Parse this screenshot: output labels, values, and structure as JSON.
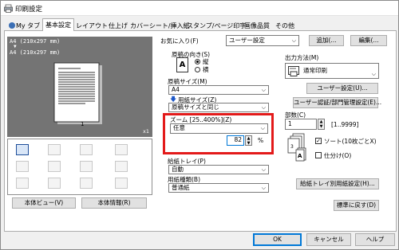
{
  "window": {
    "title": "印刷設定"
  },
  "tabs": [
    "My タブ",
    "基本設定",
    "レイアウト",
    "仕上げ",
    "カバーシート/挿入紙",
    "スタンプ/ページ印字",
    "画像品質",
    "その他"
  ],
  "preview": {
    "line1": "A4 (210x297 mm)",
    "line2": "A4 (210x297 mm)",
    "page_number": "1",
    "zoom": "x1"
  },
  "left_buttons": {
    "view": "本体ビュー(V)",
    "info": "本体情報(R)"
  },
  "favorites": {
    "label": "お気に入り(F)",
    "value": "ユーザー設定",
    "add": "追加(...",
    "edit": "編集(..."
  },
  "orientation": {
    "label": "原稿の向き(S)",
    "portrait": "縦",
    "landscape": "横"
  },
  "original_size": {
    "label": "原稿サイズ(M)",
    "value": "A4",
    "paper_size_label": "用紙サイズ(Z)",
    "paper_size_value": "原稿サイズと同じ"
  },
  "zoom": {
    "label": "ズーム [25..400%](Z)",
    "mode": "任意",
    "value": "82",
    "unit": "%"
  },
  "tray": {
    "label": "給紙トレイ(P)",
    "value": "自動",
    "type_label": "用紙種類(B)",
    "type_value": "普通紙"
  },
  "output": {
    "label": "出力方法(M)",
    "value": "通常印刷",
    "user_settings": "ユーザー設定(U)...",
    "auth": "ユーザー認証/部門管理設定(E)..."
  },
  "copies": {
    "label": "部数(C)",
    "value": "1",
    "range": "[1..9999]",
    "sort": "ソート(10枚ごとX)",
    "separate": "仕分け(O)"
  },
  "tray_settings": "給紙トレイ別用紙設定(H)...",
  "restore_default": "標準に戻す(D)",
  "dialog_buttons": {
    "ok": "OK",
    "cancel": "キャンセル",
    "help": "ヘルプ"
  }
}
